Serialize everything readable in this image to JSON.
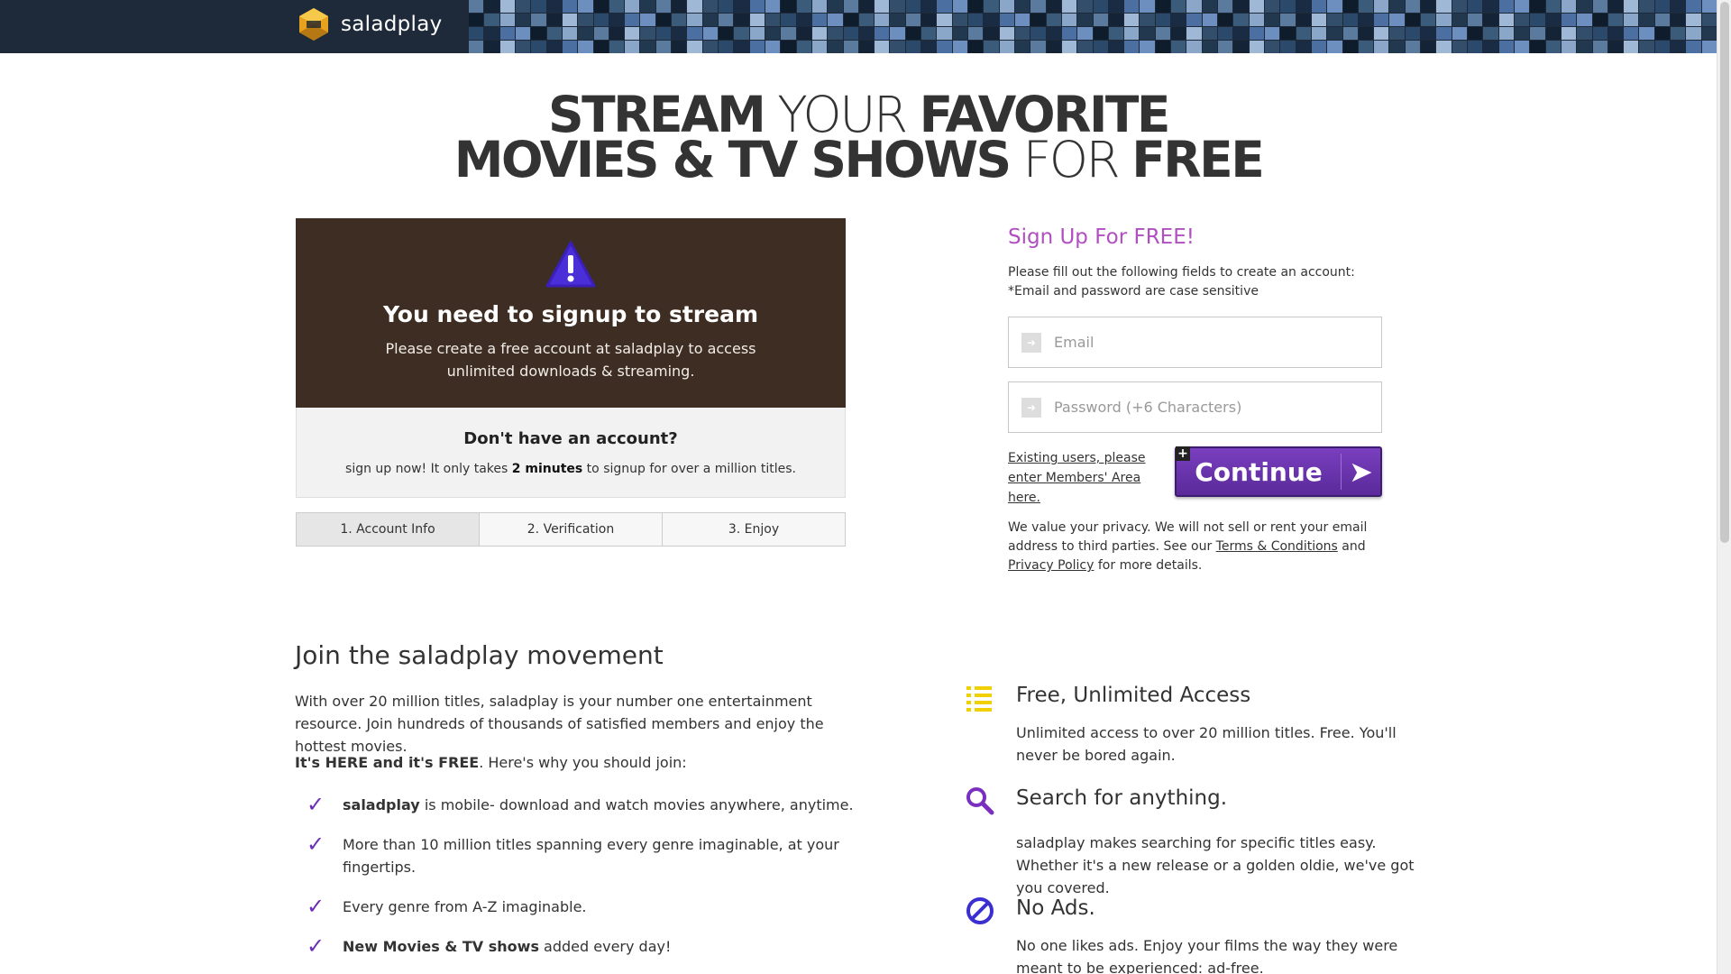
{
  "header": {
    "logo_text": "saladplay"
  },
  "hero": {
    "line1_bold1": "STREAM",
    "line1_thin": " YOUR ",
    "line1_bold2": "FAVORITE",
    "line2_bold1": "MOVIES & TV SHOWS",
    "line2_thin": " FOR ",
    "line2_bold2": "FREE"
  },
  "notice": {
    "title": "You need to signup to stream",
    "text": "Please create a free account at saladplay to access unlimited downloads & streaming."
  },
  "account": {
    "title": "Don't have an account?",
    "text_before": "sign up now! It only takes ",
    "text_bold": "2 minutes",
    "text_after": " to signup for over a million titles."
  },
  "steps": [
    "1. Account Info",
    "2. Verification",
    "3. Enjoy"
  ],
  "signup": {
    "title": "Sign Up For FREE!",
    "desc_line1": "Please fill out the following fields to create an account:",
    "desc_line2": "*Email and password are case sensitive",
    "email_placeholder": "Email",
    "password_placeholder": "Password (+6 Characters)",
    "existing_link": "Existing users, please enter Members' Area here.",
    "continue_label": "Continue",
    "privacy_before": "We value your privacy. We will not sell or rent your email address to third parties. See our ",
    "terms_link": "Terms & Conditions",
    "privacy_mid": " and ",
    "privacy_link": "Privacy Policy",
    "privacy_after": " for more details."
  },
  "movement": {
    "title": "Join the saladplay movement",
    "intro": "With over 20 million titles, saladplay is your number one entertainment resource. Join hundreds of thousands of satisfied members and enjoy the hottest movies.",
    "why_bold": "It's HERE and it's FREE",
    "why_rest": ". Here's why you should join:",
    "benefits": [
      {
        "bold": "saladplay",
        "text": " is mobile- download and watch movies anywhere, anytime."
      },
      {
        "bold": "",
        "text": "More than 10 million titles spanning every genre imaginable, at your fingertips."
      },
      {
        "bold": "",
        "text": "Every genre from A-Z imaginable."
      },
      {
        "bold": "New Movies & TV shows",
        "text": " added every day!"
      }
    ]
  },
  "features": [
    {
      "icon": "list-icon",
      "title": "Free, Unlimited Access",
      "desc": "Unlimited access to over 20 million titles. Free. You'll never be bored again."
    },
    {
      "icon": "search-icon",
      "title": "Search for anything.",
      "desc": "saladplay makes searching for specific titles easy. Whether it's a new release or a golden oldie, we've got you covered."
    },
    {
      "icon": "no-ads-icon",
      "title": "No Ads.",
      "desc": "No one likes ads. Enjoy your films the way they were meant to be experienced: ad-free."
    }
  ],
  "colors": {
    "accent_purple": "#6a2fb5",
    "signup_title": "#b04fc0",
    "notice_bg": "#3d2d22",
    "list_icon_yellow": "#f0d000"
  }
}
